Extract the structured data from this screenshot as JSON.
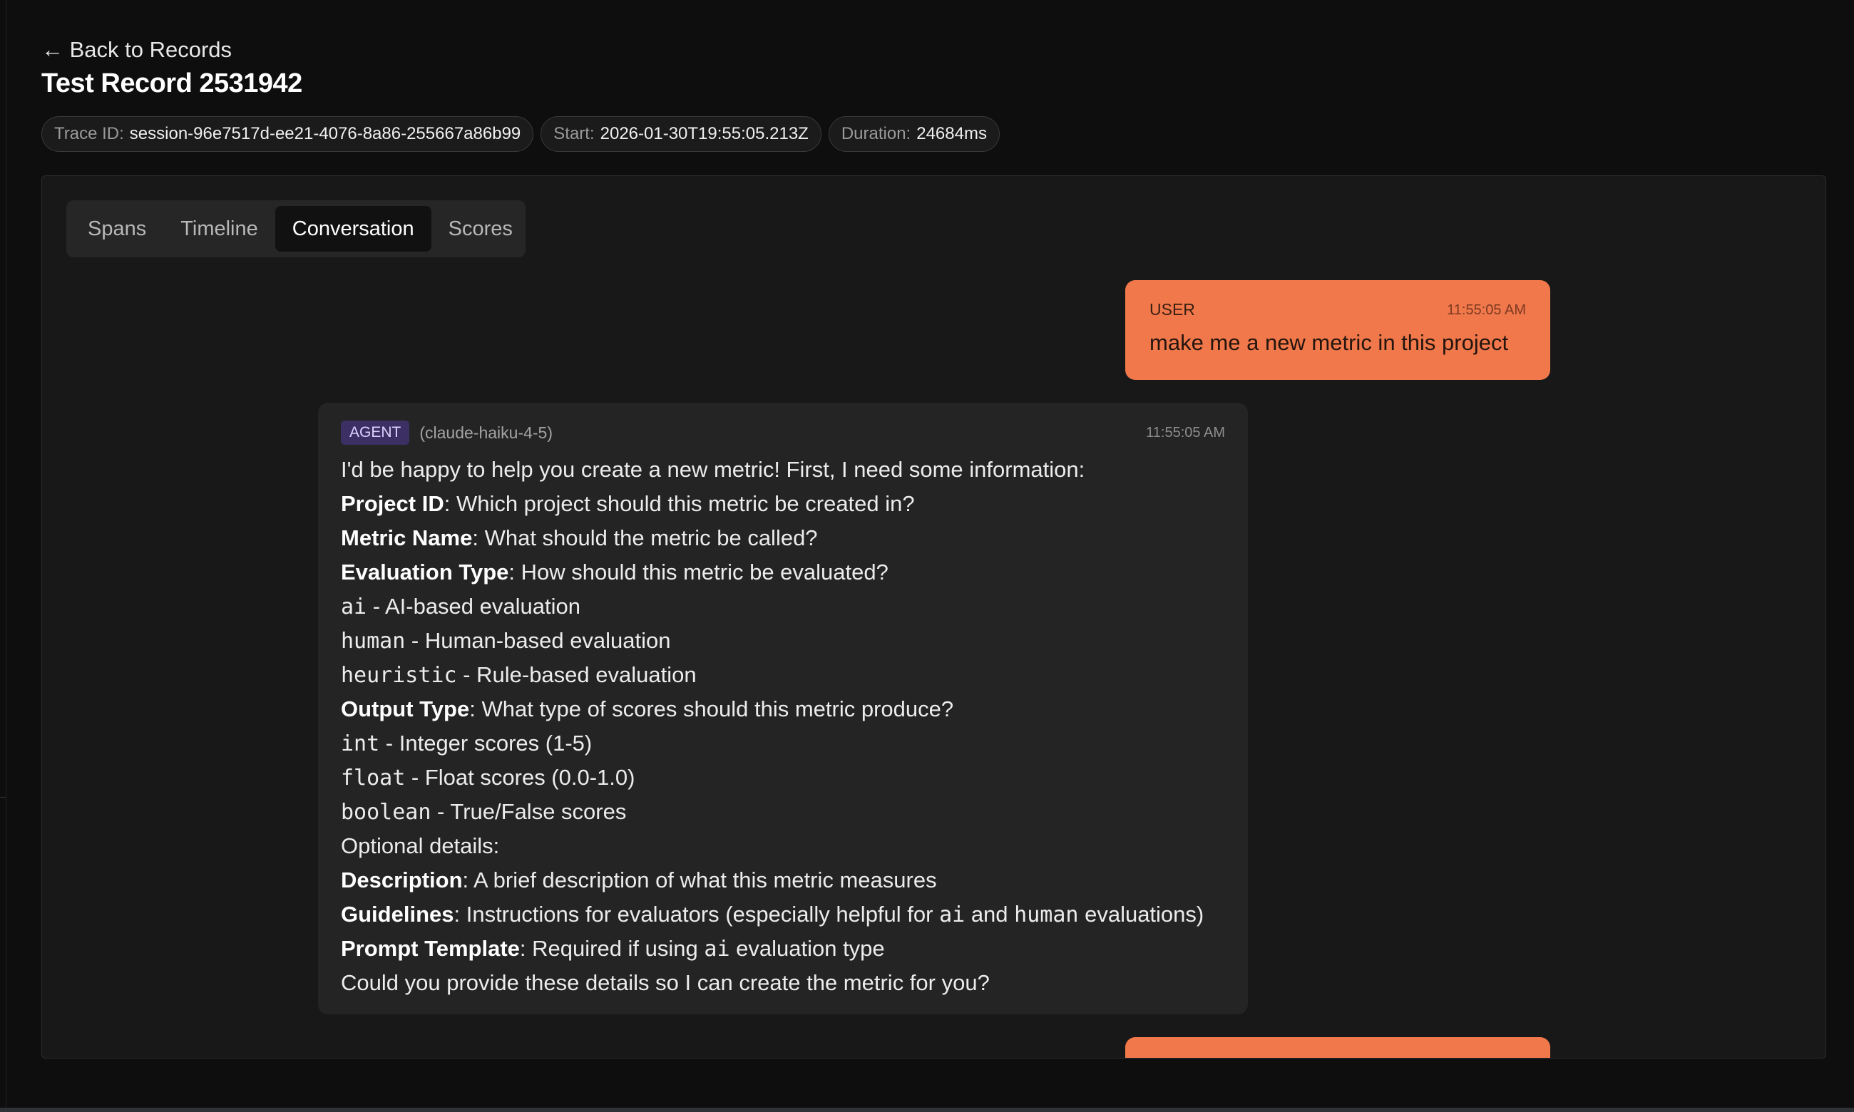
{
  "nav": {
    "back_label": "← Back to Records"
  },
  "record": {
    "title": "Test Record 2531942"
  },
  "meta": [
    {
      "key": "Trace ID:",
      "value": "session-96e7517d-ee21-4076-8a86-255667a86b99"
    },
    {
      "key": "Start:",
      "value": "2026-01-30T19:55:05.213Z"
    },
    {
      "key": "Duration:",
      "value": "24684ms"
    }
  ],
  "tabs": [
    "Spans",
    "Timeline",
    "Conversation",
    "Scores"
  ],
  "active_tab": "Conversation",
  "messages": {
    "user": {
      "role": "USER",
      "time": "11:55:05 AM",
      "text": "make me a new metric in this project"
    },
    "agent": {
      "role": "AGENT",
      "model": "(claude-haiku-4-5)",
      "time": "11:55:05 AM",
      "lines": {
        "intro": "I'd be happy to help you create a new metric! First, I need some information:",
        "project_label": "Project ID",
        "project_text": ": Which project should this metric be created in?",
        "name_label": "Metric Name",
        "name_text": ": What should the metric be called?",
        "eval_label": "Evaluation Type",
        "eval_text": ": How should this metric be evaluated?",
        "eval_ai_code": "ai",
        "eval_ai_text": " - AI-based evaluation",
        "eval_human_code": "human",
        "eval_human_text": " - Human-based evaluation",
        "eval_heur_code": "heuristic",
        "eval_heur_text": " - Rule-based evaluation",
        "output_label": "Output Type",
        "output_text": ": What type of scores should this metric produce?",
        "out_int_code": "int",
        "out_int_text": " - Integer scores (1-5)",
        "out_float_code": "float",
        "out_float_text": " - Float scores (0.0-1.0)",
        "out_bool_code": "boolean",
        "out_bool_text": " - True/False scores",
        "optional": "Optional details:",
        "desc_label": "Description",
        "desc_text": ": A brief description of what this metric measures",
        "guide_label": "Guidelines",
        "guide_text_1": ": Instructions for evaluators (especially helpful for ",
        "guide_code_1": "ai",
        "guide_text_2": " and ",
        "guide_code_2": "human",
        "guide_text_3": " evaluations)",
        "prompt_label": "Prompt Template",
        "prompt_text_1": ": Required if using ",
        "prompt_code": "ai",
        "prompt_text_2": " evaluation type",
        "closing": "Could you provide these details so I can create the metric for you?"
      }
    }
  },
  "colors": {
    "user_bubble": "#f0784a",
    "agent_badge": "#3b2f63",
    "background": "#0e0e0e"
  }
}
